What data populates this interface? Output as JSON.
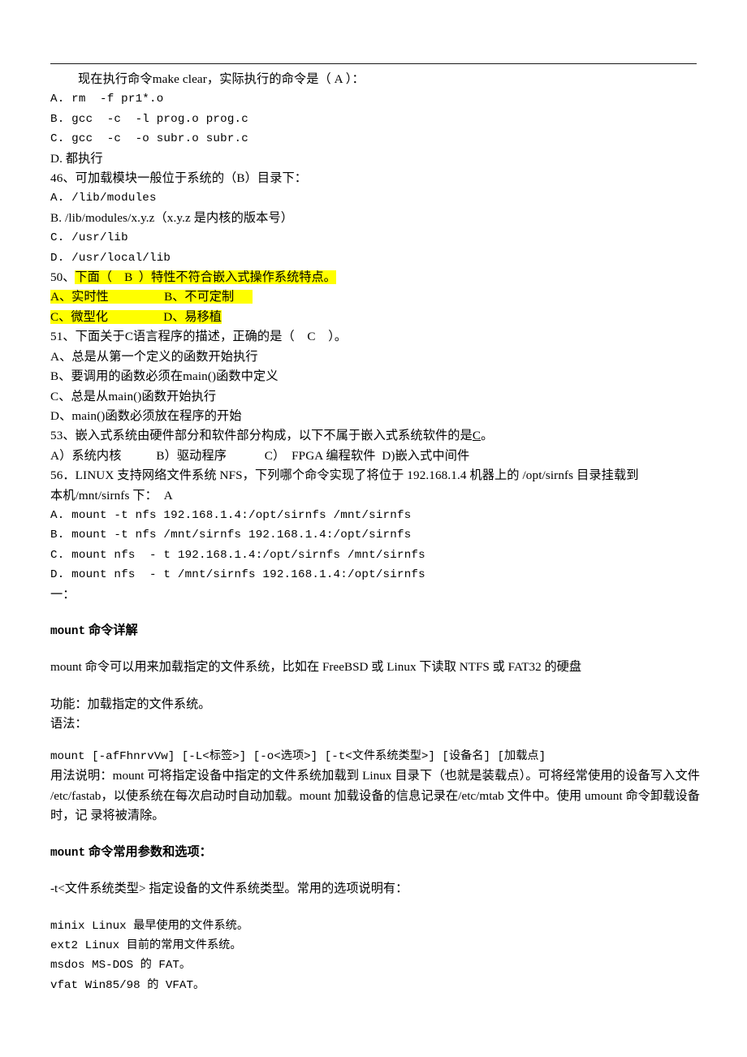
{
  "document": {
    "colors": {
      "highlight": "#ffff00",
      "text": "#000000",
      "rule": "#1a1a1a",
      "page_background": "#ffffff"
    }
  },
  "questions": {
    "q45_tail": {
      "stem": "现在执行命令make clear，实际执行的命令是（ A ）：",
      "options": [
        "A. rm  -f pr1*.o",
        "B. gcc  -c  -l prog.o prog.c",
        "C. gcc  -c  -o subr.o subr.c",
        "D. 都执行"
      ]
    },
    "q46": {
      "stem": "46、可加载模块一般位于系统的（B）目录下：",
      "options": [
        "A. /lib/modules",
        "B. /lib/modules/x.y.z（x.y.z 是内核的版本号）",
        "C. /usr/lib",
        "D. /usr/local/lib"
      ]
    },
    "q50": {
      "number": "50、",
      "stem": "下面（    B  ）特性不符合嵌入式操作系统特点。",
      "option_a": "A、实时性",
      "option_b": "B、不可定制",
      "option_c": "C、微型化",
      "option_d": "D、易移植",
      "highlighted": "true"
    },
    "q51": {
      "stem": "51、下面关于C语言程序的描述，正确的是（    C    ）。",
      "options": [
        "A、总是从第一个定义的函数开始执行",
        "B、要调用的函数必须在main()函数中定义",
        "C、总是从main()函数开始执行",
        "D、main()函数必须放在程序的开始"
      ]
    },
    "q53": {
      "stem_before_answer": "53、嵌入式系统由硬件部分和软件部分构成，以下不属于嵌入式系统软件的是",
      "answer": "C",
      "stem_after_answer": "。",
      "options_line": "A）系统内核           B）驱动程序            C）  FPGA 编程软件  D)嵌入式中间件"
    },
    "q56": {
      "stem_line1": "56．LINUX 支持网络文件系统 NFS，下列哪个命令实现了将位于 192.168.1.4 机器上的 /opt/sirnfs 目录挂载到",
      "stem_line2": "本机/mnt/sirnfs 下：  A",
      "options": [
        "A. mount -t nfs 192.168.1.4:/opt/sirnfs /mnt/sirnfs",
        "B. mount -t nfs /mnt/sirnfs 192.168.1.4:/opt/sirnfs",
        "C. mount nfs  - t 192.168.1.4:/opt/sirnfs /mnt/sirnfs",
        "D. mount nfs  - t /mnt/sirnfs 192.168.1.4:/opt/sirnfs"
      ]
    },
    "section_marker": "一："
  },
  "mount_article": {
    "title_code": "mount",
    "title_text": " 命令详解",
    "intro": "mount 命令可以用来加载指定的文件系统，比如在 FreeBSD 或 Linux 下读取 NTFS 或 FAT32 的硬盘",
    "function_line": "功能：加载指定的文件系统。",
    "syntax_label": "语法：",
    "syntax": "mount [-afFhnrvVw] [-L<标签>] [-o<选项>] [-t<文件系统类型>] [设备名] [加载点]",
    "usage_note": "用法说明：mount 可将指定设备中指定的文件系统加载到 Linux 目录下（也就是装载点）。可将经常使用的设备写入文件 /etc/fastab，以使系统在每次启动时自动加载。mount 加载设备的信息记录在/etc/mtab 文件中。使用 umount 命令卸载设备时，记 录将被清除。",
    "params_title_code": "mount",
    "params_title_text": " 命令常用参数和选项：",
    "param_t": "-t<文件系统类型> 指定设备的文件系统类型。常用的选项说明有：",
    "fs_types": [
      "minix Linux 最早使用的文件系统。",
      "ext2 Linux 目前的常用文件系统。",
      "msdos MS-DOS 的 FAT。",
      "vfat Win85/98 的 VFAT。"
    ]
  }
}
